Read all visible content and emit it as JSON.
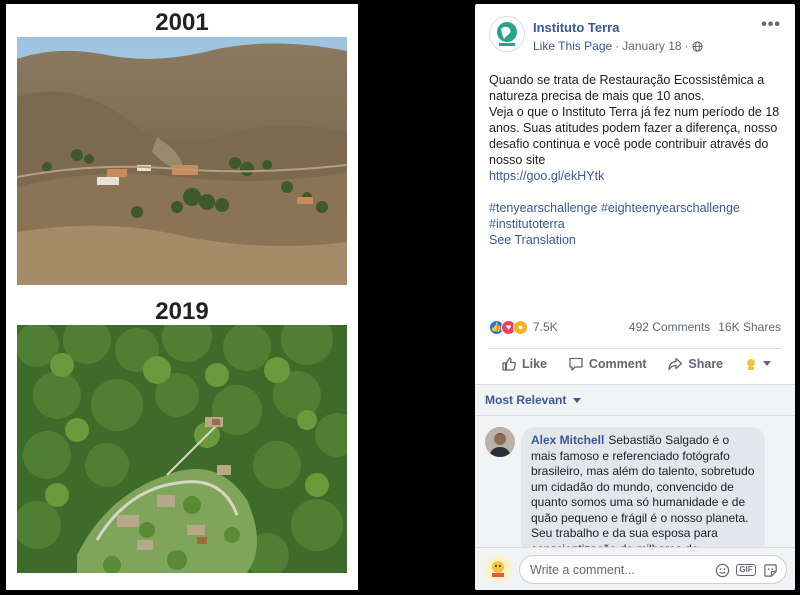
{
  "photos": {
    "before_year": "2001",
    "after_year": "2019"
  },
  "post": {
    "page_name": "Instituto Terra",
    "like_page": "Like This Page",
    "date": "January 18",
    "separator": "·",
    "more": "•••",
    "text_line_1": "Quando se trata de Restauração Ecossistêmica a natureza precisa de mais que 10 anos.",
    "text_line_2": "Veja o que o Instituto Terra já fez num período de 18 anos. Suas atitudes podem fazer a diferença, nosso desafio continua e você pode contribuir através do nosso site",
    "link": "https://goo.gl/ekHYtk",
    "hashtags_1": "#tenyearschallenge #eighteenyearschallenge",
    "hashtags_2": "#institutoterra",
    "see_translation": "See Translation"
  },
  "reactions": {
    "count": "7.5K",
    "comments": "492 Comments",
    "shares": "16K Shares"
  },
  "actions": {
    "like": "Like",
    "comment": "Comment",
    "share": "Share"
  },
  "comments": {
    "sort_label": "Most Relevant",
    "items": [
      {
        "author": "Alex Mitchell",
        "text": "Sebastião Salgado é o mais famoso e referenciado fotógrafo brasileiro, mas além do talento, sobretudo um cidadão do mundo, convencido de quanto somos uma só humanidade e de quão pequeno e frágil é o nosso planeta. Seu trabalho e da sua esposa para conscientização de milhares de"
      }
    ],
    "composer_placeholder": "Write a comment...",
    "gif_label": "GIF"
  },
  "colors": {
    "link": "#385898",
    "like_blue": "#1877f2",
    "love_red": "#f33e58",
    "wow_yellow": "#f7b125"
  }
}
